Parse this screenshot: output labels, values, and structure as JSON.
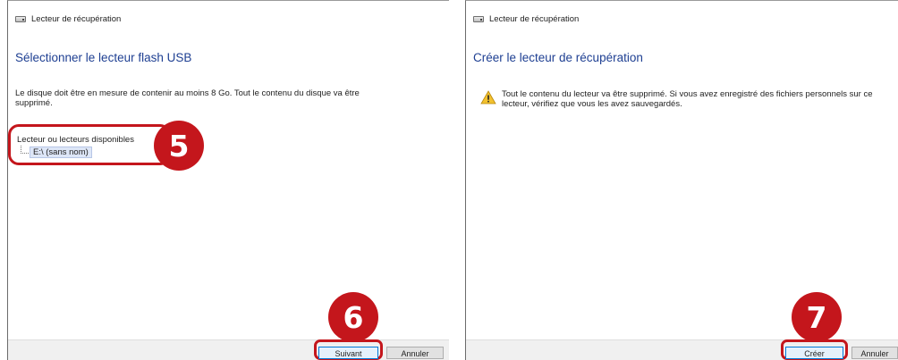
{
  "left_window": {
    "title": "Lecteur de récupération",
    "heading": "Sélectionner le lecteur flash USB",
    "description": "Le disque doit être en mesure de contenir au moins 8 Go. Tout le contenu du disque va être supprimé.",
    "drives_label": "Lecteur ou lecteurs disponibles",
    "drives": [
      "E:\\ (sans nom)"
    ],
    "buttons": {
      "next": "Suivant",
      "cancel": "Annuler"
    }
  },
  "right_window": {
    "title": "Lecteur de récupération",
    "heading": "Créer le lecteur de récupération",
    "warning_text": "Tout le contenu du lecteur va être supprimé. Si vous avez enregistré des fichiers personnels sur ce lecteur, vérifiez que vous les avez sauvegardés.",
    "buttons": {
      "create": "Créer",
      "cancel": "Annuler"
    }
  },
  "step_badges": [
    "5",
    "6",
    "7"
  ],
  "icons": [
    "drive-icon",
    "warning-icon"
  ],
  "colors": {
    "heading": "#1e3f92",
    "highlight": "#c4161c",
    "selection": "#dde6f7",
    "footer": "#f0f0f0"
  }
}
